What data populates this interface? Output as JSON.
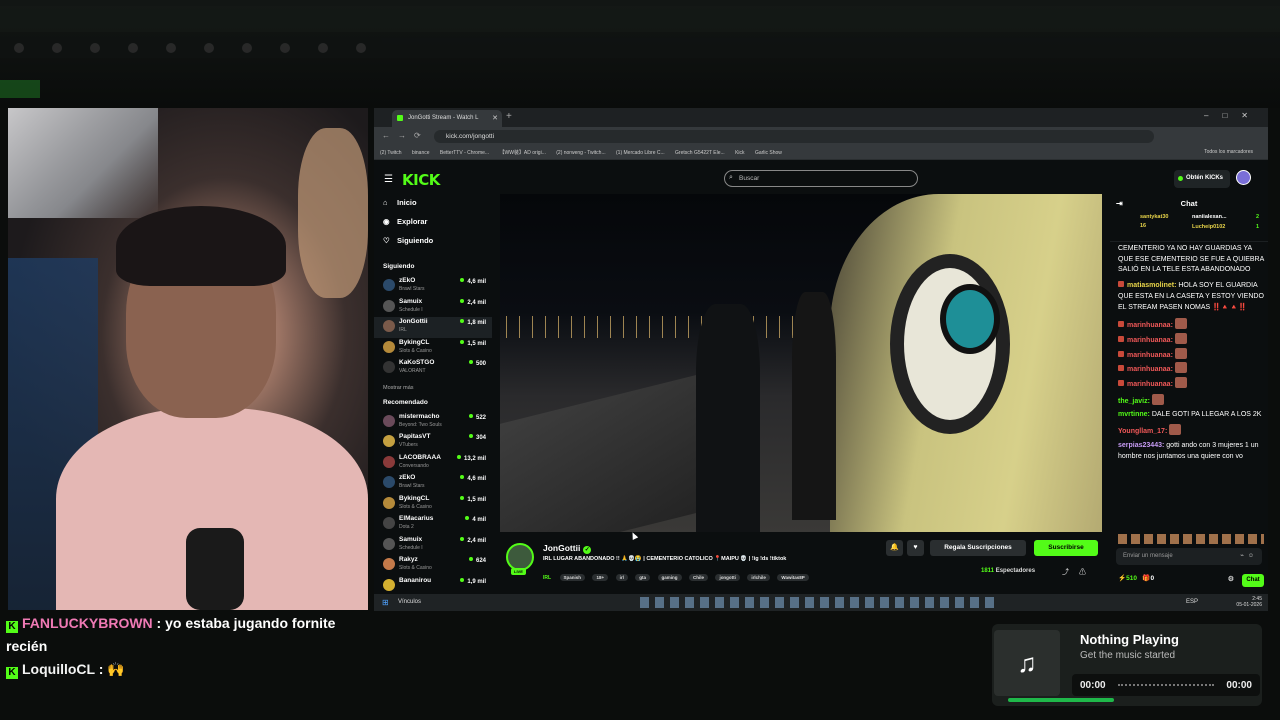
{
  "overlay_chat": [
    {
      "user": "FANLUCKYBROWN",
      "text": "yo estaba jugando fornite recién"
    },
    {
      "user": "LoquilloCL",
      "text": "🙌"
    }
  ],
  "music": {
    "title": "Nothing Playing",
    "subtitle": "Get the music started",
    "time_start": "00:00",
    "time_end": "00:00"
  },
  "browser": {
    "tab_title": "JonGotti Stream - Watch L",
    "url": "kick.com/jongotti",
    "bookmarks": [
      "(2) Twitch",
      "binance",
      "BetterTTV - Chrome...",
      "【WW装】AD origi...",
      "(2) norweng - Twitch...",
      "(1) Mercado Libre C...",
      "Gretsch G5422T Ele...",
      "Kick",
      "Garlic Show"
    ],
    "all_bookmarks": "Todos los marcadores"
  },
  "kick": {
    "logo": "KICK",
    "search_placeholder": "Buscar",
    "get_kicks": "Obtén KICKs",
    "nav": {
      "home": "Inicio",
      "explore": "Explorar",
      "following": "Siguiendo"
    },
    "following_title": "Siguiendo",
    "following": [
      {
        "name": "zEkO",
        "category": "Brawl Stars",
        "viewers": "4,6 mil"
      },
      {
        "name": "Samuix",
        "category": "Schedule I",
        "viewers": "2,4 mil"
      },
      {
        "name": "JonGottii",
        "category": "IRL",
        "viewers": "1,8 mil"
      },
      {
        "name": "BykingCL",
        "category": "Slots & Casino",
        "viewers": "1,5 mil"
      },
      {
        "name": "KaKoSTGO",
        "category": "VALORANT",
        "viewers": "500"
      }
    ],
    "show_more": "Mostrar más",
    "recommended_title": "Recomendado",
    "recommended": [
      {
        "name": "mistermacho",
        "category": "Beyond: Two Souls",
        "viewers": "522"
      },
      {
        "name": "PapitasVT",
        "category": "VTubers",
        "viewers": "304"
      },
      {
        "name": "LACOBRAAA",
        "category": "Conversando",
        "viewers": "13,2 mil"
      },
      {
        "name": "zEkO",
        "category": "Brawl Stars",
        "viewers": "4,6 mil"
      },
      {
        "name": "BykingCL",
        "category": "Slots & Casino",
        "viewers": "1,5 mil"
      },
      {
        "name": "ElMacarius",
        "category": "Dota 2",
        "viewers": "4 mil"
      },
      {
        "name": "Samuix",
        "category": "Schedule I",
        "viewers": "2,4 mil"
      },
      {
        "name": "Rakyz",
        "category": "Slots & Casino",
        "viewers": "624"
      },
      {
        "name": "Bananirou",
        "category": "",
        "viewers": "1,9 mil"
      }
    ],
    "stream": {
      "streamer": "JonGottii",
      "live_label": "LIVE",
      "title": "IRL LUGAR ABANDONADO !! 🙏💀😭 | CEMENTERIO CATOLICO 📍MAIPU 💀 | !ig !ds !tiktok",
      "category": "IRL",
      "tags": [
        "Spanish",
        "18+",
        "irl",
        "gta",
        "gaming",
        "Chile",
        "jongotti",
        "irlchile",
        "Wawitas8P"
      ],
      "gift_subs": "Regala Suscripciones",
      "subscribe": "Suscribirse",
      "viewers": "1811",
      "viewers_label": "Espectadores"
    },
    "chat": {
      "title": "Chat",
      "pinned": [
        {
          "user": "santykat30",
          "count": "16"
        },
        {
          "user": "naniialexan...",
          "count": "2"
        },
        {
          "user": "Lucheip0102",
          "count": "1"
        }
      ],
      "messages": [
        {
          "user": "",
          "text": "CEMENTERIO YA NO HAY GUARDIAS YA QUE ESE CEMENTERIO SE FUE A QUIEBRA SALIÓ EN LA TELE ESTA ABANDONADO",
          "color": "red"
        },
        {
          "user": "matiasmolinet:",
          "text": "HOLA SOY EL GUARDIA QUE ESTA EN LA CASETA Y ESTOY VIENDO EL STREAM PASEN NOMAS ‼️🔺🔺‼️",
          "color": "yel"
        },
        {
          "user": "marinhuanaa:",
          "text": "",
          "color": "red"
        },
        {
          "user": "marinhuanaa:",
          "text": "",
          "color": "red"
        },
        {
          "user": "marinhuanaa:",
          "text": "",
          "color": "red"
        },
        {
          "user": "marinhuanaa:",
          "text": "",
          "color": "red"
        },
        {
          "user": "marinhuanaa:",
          "text": "",
          "color": "red"
        },
        {
          "user": "the_javiz:",
          "text": "",
          "color": "grn"
        },
        {
          "user": "mvrtinne:",
          "text": "DALE GOTI PA LLEGAR A LOS 2K",
          "color": "grn"
        },
        {
          "user": "Youngllam_17:",
          "text": "",
          "color": "red"
        },
        {
          "user": "serpias23443:",
          "text": "gotti ando con 3 mujeres 1 un hombre nos juntamos una quiere con vo",
          "color": "pur"
        }
      ],
      "input_placeholder": "Enviar un mensaje",
      "kicks": "510",
      "gifts": "0",
      "send": "Chat"
    }
  },
  "taskbar": {
    "start_label": "Vínculos",
    "lang": "ESP",
    "time": "2:45",
    "date": "05-01-2026"
  }
}
